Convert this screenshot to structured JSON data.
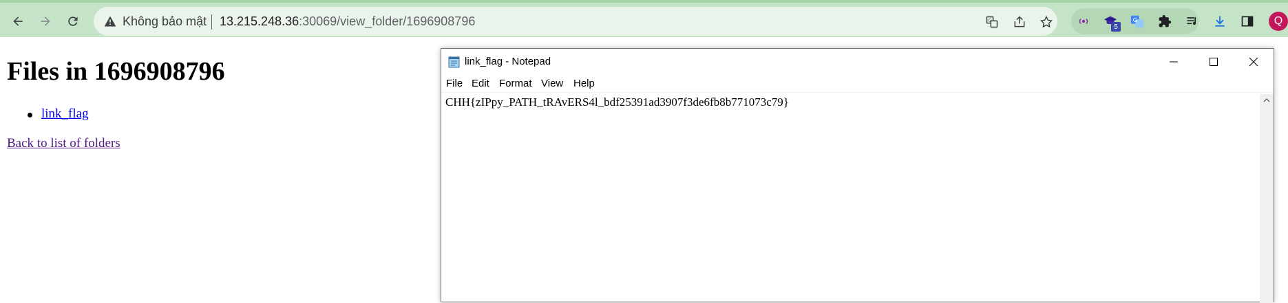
{
  "browser": {
    "security_label": "Không bảo mật",
    "url_host": "13.215.248.36",
    "url_rest": ":30069/view_folder/1696908796",
    "avatar_initial": "Q",
    "extension_badge": "5",
    "colors": {
      "toolbar": "#c5e3c7",
      "omnibox": "#eaf4ea",
      "avatar": "#c2185b"
    }
  },
  "page": {
    "title": "Files in 1696908796",
    "files": [
      {
        "label": "link_flag"
      }
    ],
    "back_link": "Back to list of folders"
  },
  "notepad": {
    "title": "link_flag - Notepad",
    "menu": [
      "File",
      "Edit",
      "Format",
      "View",
      "Help"
    ],
    "content": "CHH{zIPpy_PATH_tRAvERS4l_bdf25391ad3907f3de6fb8b771073c79}"
  }
}
